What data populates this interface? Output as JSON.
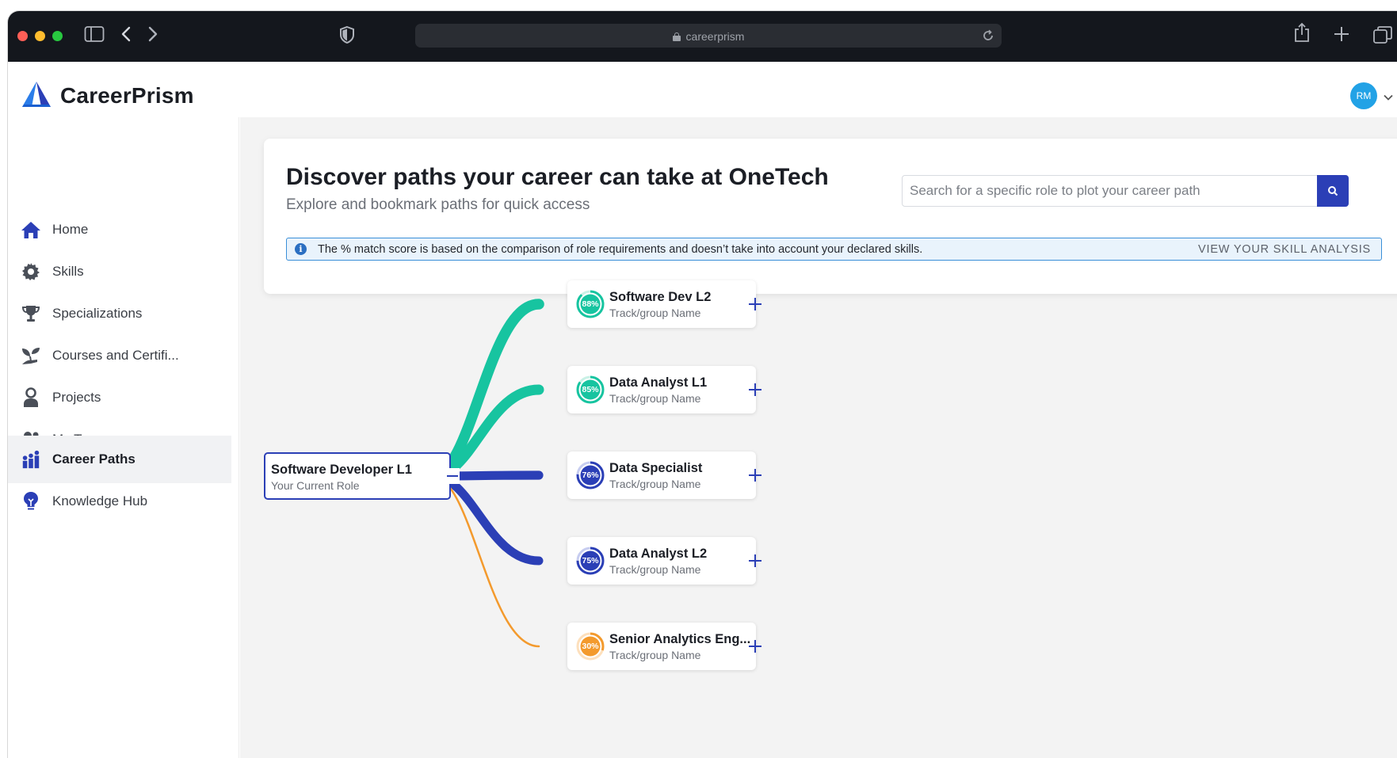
{
  "browser": {
    "url": "careerprism"
  },
  "app": {
    "name": "CareerPrism",
    "avatar_initials": "RM",
    "brand_color": "#2b3fb6"
  },
  "sidebar": {
    "items": [
      {
        "label": "Home",
        "icon": "home-icon"
      },
      {
        "label": "Skills",
        "icon": "gear-icon"
      },
      {
        "label": "Specializations",
        "icon": "trophy-icon"
      },
      {
        "label": "Courses and Certifi...",
        "icon": "seedling-icon"
      },
      {
        "label": "Projects",
        "icon": "person-icon"
      },
      {
        "label": "My Team",
        "icon": "team-icon",
        "expandable": true
      },
      {
        "label": "Career Paths",
        "icon": "career-paths-icon",
        "active": true
      },
      {
        "label": "Knowledge Hub",
        "icon": "lightbulb-icon"
      }
    ]
  },
  "hero": {
    "title": "Discover paths your career can take at OneTech",
    "subtitle": "Explore and bookmark paths for quick access",
    "search_placeholder": "Search for a specific role to plot your career path",
    "info_text": "The % match score is based on the comparison of role requirements and doesn’t take into account your declared skills.",
    "info_link": "VIEW YOUR SKILL ANALYSIS"
  },
  "current_role": {
    "title": "Software Developer L1",
    "subtitle": "Your Current Role"
  },
  "paths": [
    {
      "title": "Software Dev L2",
      "subtitle": "Track/group Name",
      "match": 88,
      "match_label": "88%",
      "color": "#17c4a0"
    },
    {
      "title": "Data Analyst L1",
      "subtitle": "Track/group Name",
      "match": 85,
      "match_label": "85%",
      "color": "#17c4a0"
    },
    {
      "title": "Data Specialist",
      "subtitle": "Track/group Name",
      "match": 76,
      "match_label": "76%",
      "color": "#2b3fb6"
    },
    {
      "title": "Data Analyst L2",
      "subtitle": "Track/group Name",
      "match": 75,
      "match_label": "75%",
      "color": "#2b3fb6"
    },
    {
      "title": "Senior Analytics Eng...",
      "subtitle": "Track/group Name",
      "match": 30,
      "match_label": "30%",
      "color": "#f39a2d"
    }
  ]
}
